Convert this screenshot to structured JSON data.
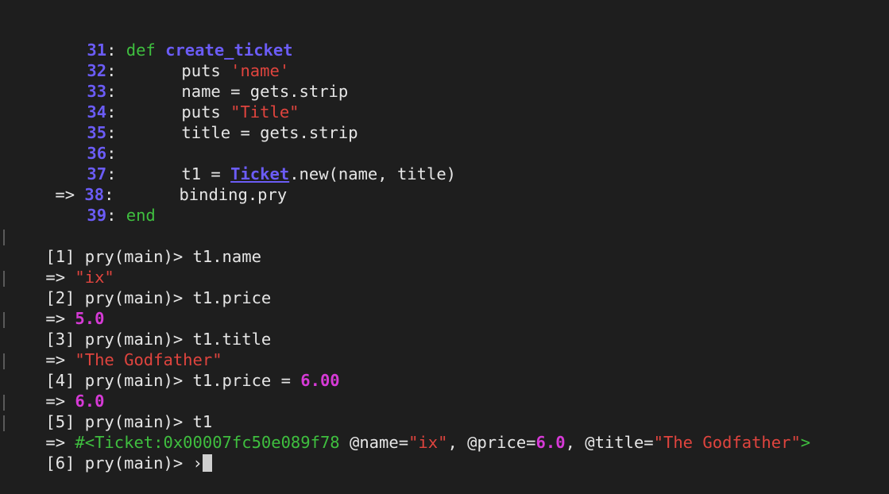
{
  "code": {
    "lines": [
      {
        "arrow": "",
        "num": "31",
        "colon": ":",
        "text_kw": "def",
        "text_fn": "create_ticket"
      },
      {
        "arrow": "",
        "num": "32",
        "colon": ":",
        "pre": "puts ",
        "str": "'name'"
      },
      {
        "arrow": "",
        "num": "33",
        "colon": ":",
        "pre": "name = gets.strip"
      },
      {
        "arrow": "",
        "num": "34",
        "colon": ":",
        "pre": "puts ",
        "str": "\"Title\""
      },
      {
        "arrow": "",
        "num": "35",
        "colon": ":",
        "pre": "title = gets.strip"
      },
      {
        "arrow": "",
        "num": "36",
        "colon": ":"
      },
      {
        "arrow": "",
        "num": "37",
        "colon": ":",
        "pre": "t1 = ",
        "cls": "Ticket",
        "post": ".new(name, title)"
      },
      {
        "arrow": "=>",
        "num": "38",
        "colon": ":",
        "pre": "binding.pry"
      },
      {
        "arrow": "",
        "num": "39",
        "colon": ":",
        "text_kw": "end"
      }
    ]
  },
  "session": {
    "p1": {
      "prompt": "[1] pry(main)> ",
      "cmd": "t1.name",
      "out_arrow": "=> ",
      "out": "\"ix\""
    },
    "p2": {
      "prompt": "[2] pry(main)> ",
      "cmd": "t1.price",
      "out_arrow": "=> ",
      "out": "5.0"
    },
    "p3": {
      "prompt": "[3] pry(main)> ",
      "cmd": "t1.title",
      "out_arrow": "=> ",
      "out": "\"The Godfather\""
    },
    "p4": {
      "prompt": "[4] pry(main)> ",
      "cmd": "t1.price = ",
      "cmd_num": "6.00",
      "out_arrow": "=> ",
      "out": "6.0"
    },
    "p5": {
      "prompt": "[5] pry(main)> ",
      "cmd": "t1",
      "out_arrow": "=> ",
      "obj_open": "#<Ticket:0x00007fc50e089f78",
      "a1": " @name=",
      "a1v": "\"ix\"",
      "sep1": ", ",
      "a2": "@price=",
      "a2v": "6.0",
      "sep2": ", ",
      "a3": "@title=",
      "a3v": "\"The Godfather\"",
      "obj_close": ">"
    },
    "p6": {
      "prompt": "[6] pry(main)> ",
      "caret": "›"
    }
  }
}
